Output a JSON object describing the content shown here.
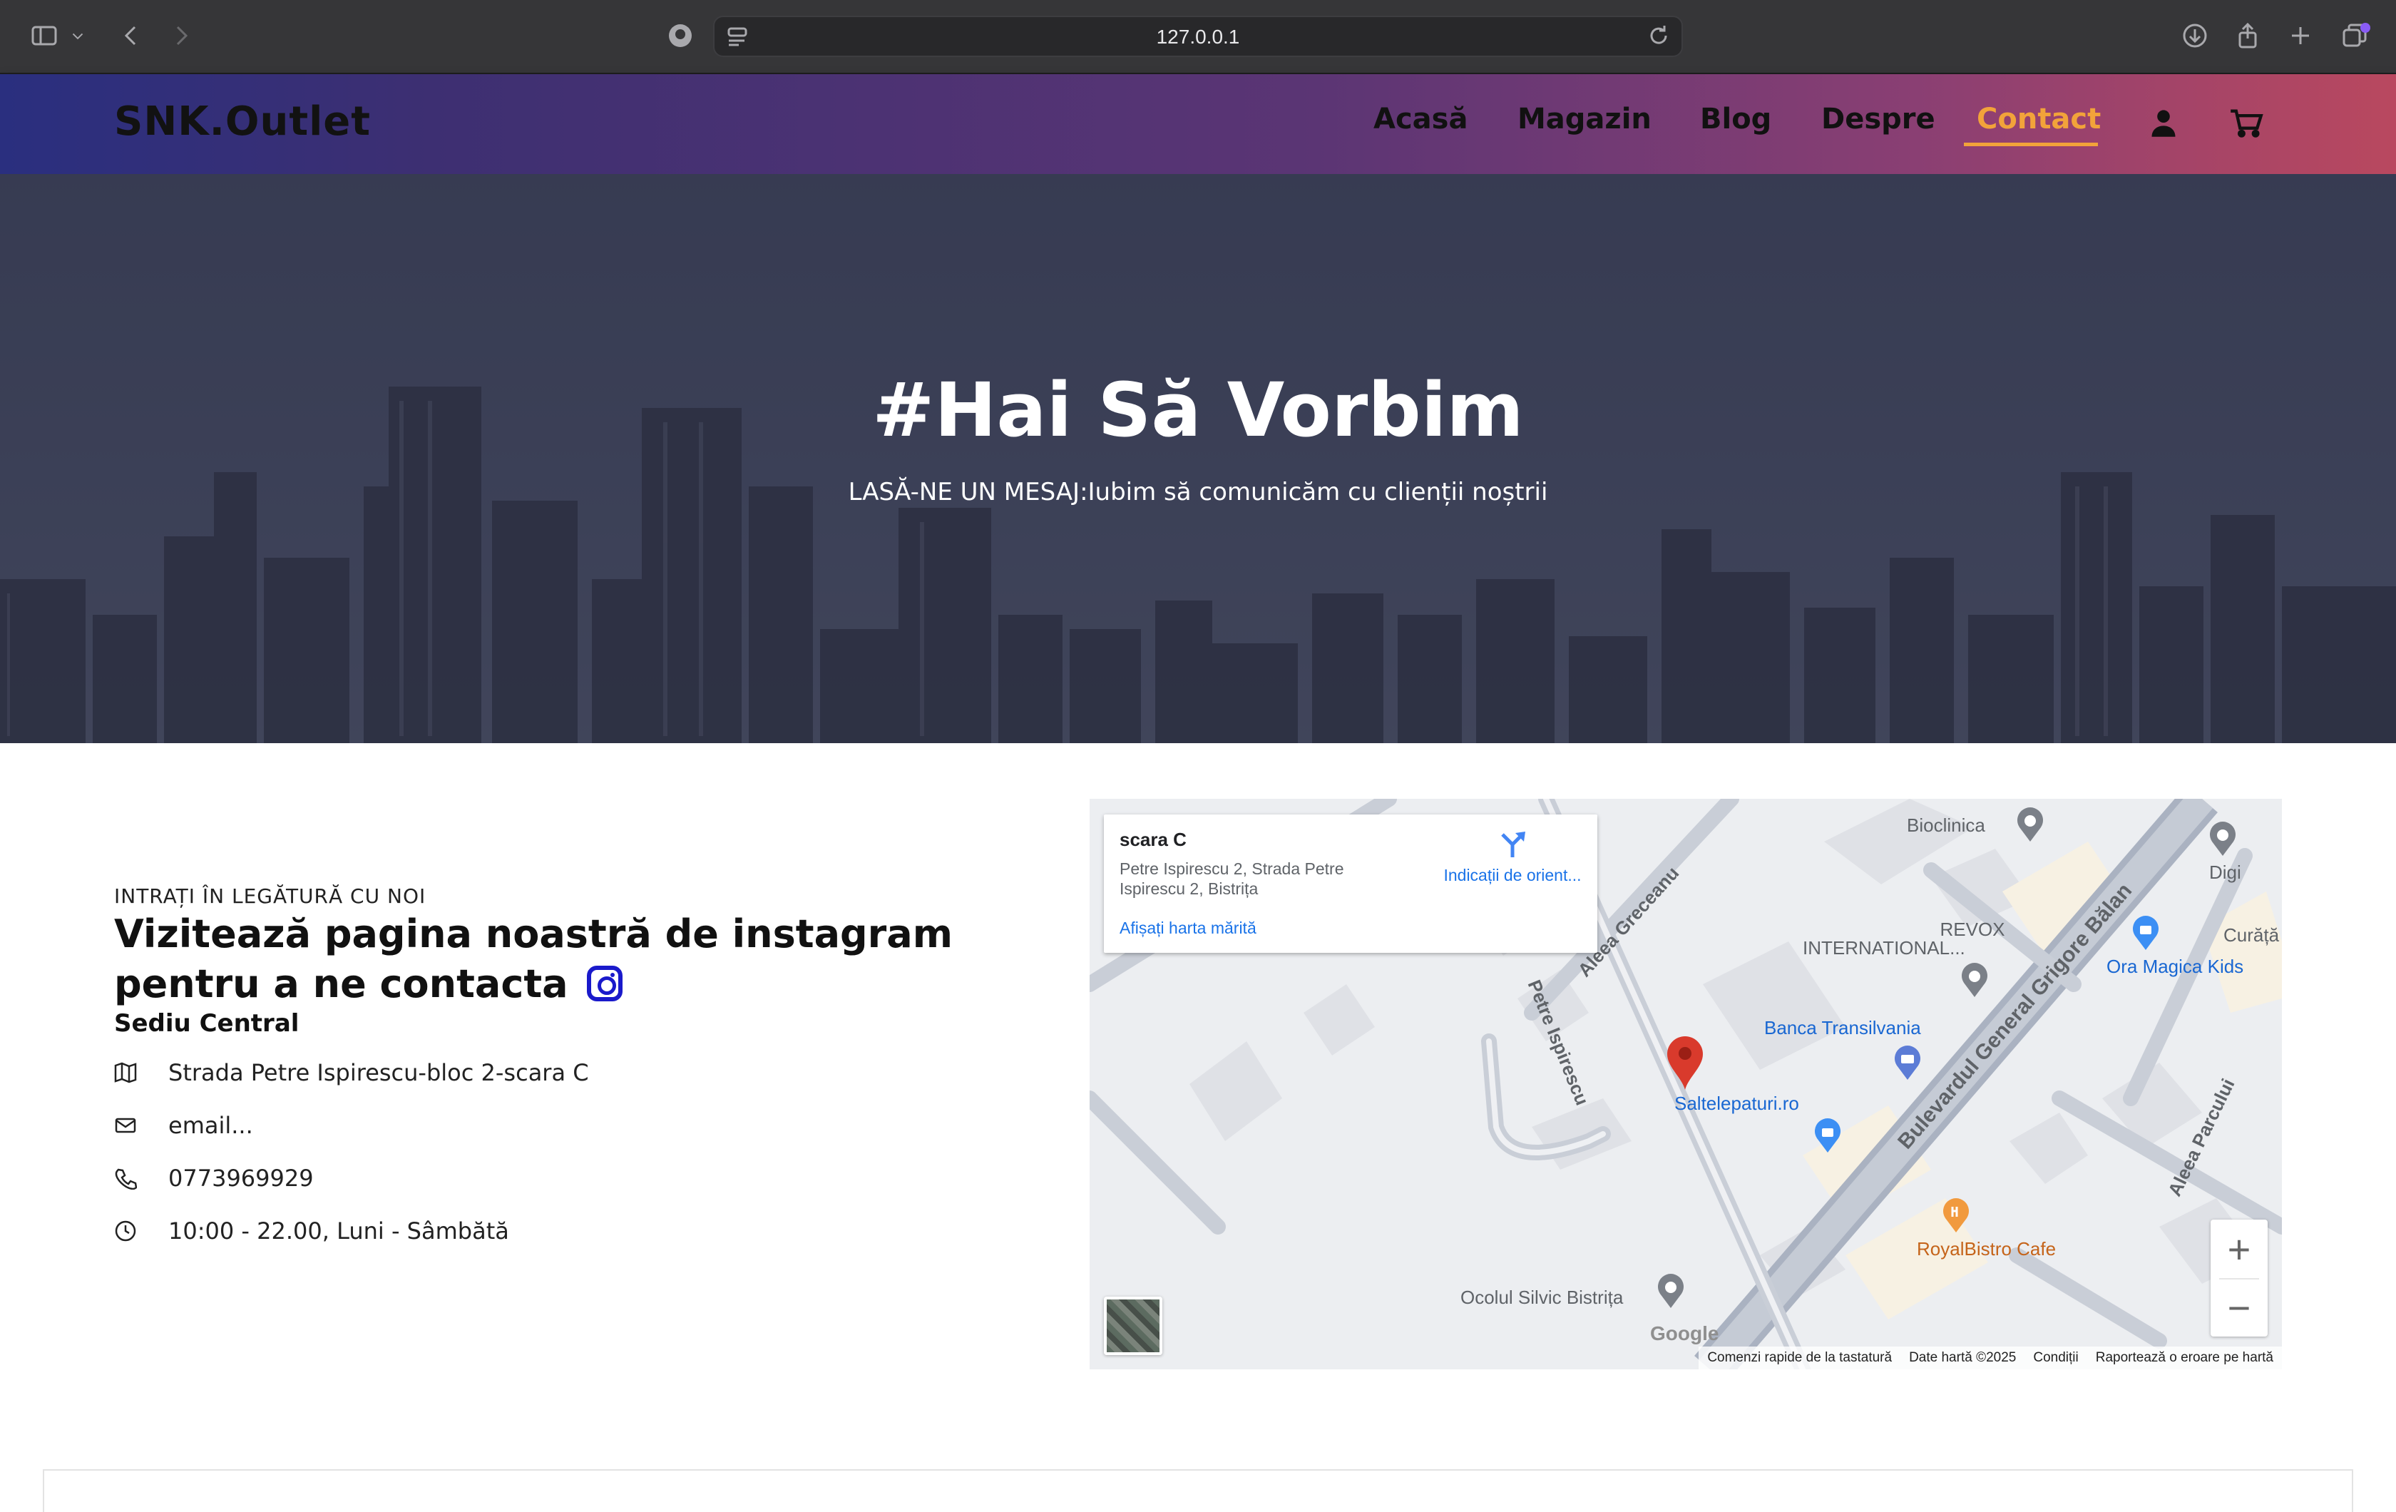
{
  "browser": {
    "url": "127.0.0.1"
  },
  "nav": {
    "brand": "SNK.Outlet",
    "items": [
      {
        "label": "Acasă"
      },
      {
        "label": "Magazin"
      },
      {
        "label": "Blog"
      },
      {
        "label": "Despre"
      },
      {
        "label": "Contact",
        "active": true
      }
    ],
    "accent_color": "#f2a33a"
  },
  "hero": {
    "title": "#Hai Să Vorbim",
    "subtitle": "LASĂ-NE UN MESAJ:Iubim să comunicăm cu clienții noștrii"
  },
  "contact": {
    "kicker": "INTRAȚI ÎN LEGĂTURĂ CU NOI",
    "headline_line1": "Vizitează pagina noastră de instagram",
    "headline_line2": "pentru a ne contacta",
    "hq_title": "Sediu Central",
    "rows": [
      {
        "icon": "map-icon",
        "text": "Strada Petre Ispirescu-bloc 2-scara C"
      },
      {
        "icon": "mail-icon",
        "text": "email..."
      },
      {
        "icon": "phone-icon",
        "text": "0773969929"
      },
      {
        "icon": "clock-icon",
        "text": "10:00 - 22.00, Luni - Sâmbătă"
      }
    ]
  },
  "map": {
    "card_title": "scara C",
    "card_address": "Petre Ispirescu 2, Strada Petre Ispirescu 2, Bistrița",
    "card_link": "Afișați harta mărită",
    "directions": "Indicații de orient...",
    "pois": {
      "bioclinica": "Bioclinica",
      "digi": "Digi",
      "revox": "REVOX",
      "revox2": "INTERNATIONAL...",
      "curata": "Curăță",
      "ora_magica": "Ora Magica Kids",
      "banca": "Banca Transilvania",
      "saltele": "Saltelepaturi.ro",
      "royal": "RoyalBistro Cafe",
      "ocolul": "Ocolul Silvic Bistrița"
    },
    "streets": {
      "greceanu": "Aleea Greceanu",
      "ispirescu": "Petre Ispirescu",
      "bulevard": "Bulevardul General Grigore Bălan",
      "parcului": "Aleea Parcului"
    },
    "zoom_in": "+",
    "zoom_out": "−",
    "logo": "Google",
    "attribution": [
      "Comenzi rapide de la tastatură",
      "Date hartă ©2025",
      "Condiții",
      "Raportează o eroare pe hartă"
    ],
    "colors": {
      "blue_poi": "#1967d2",
      "orange_poi": "#c5641a",
      "pin": "#d93a2c"
    }
  }
}
